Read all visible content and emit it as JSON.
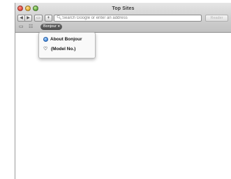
{
  "window": {
    "title": "Top Sites"
  },
  "toolbar": {
    "back_icon": "back-icon",
    "forward_icon": "forward-icon",
    "share_icon": "share-icon",
    "add_tab_label": "+",
    "address_placeholder": "Search Google or enter an address",
    "reader_label": "Reader"
  },
  "bookmarks_bar": {
    "folder_label": "Bonjour",
    "folder_chevron": "▾"
  },
  "dropdown": {
    "items": [
      {
        "label": "About Bonjour",
        "icon": "bonjour-globe-icon"
      },
      {
        "label": "(Model No.)",
        "icon": "device-icon"
      }
    ]
  },
  "colors": {
    "traffic_red": "#e0443a",
    "traffic_yellow": "#e0a82a",
    "traffic_green": "#5aa33a",
    "folder_pill": "#555555"
  }
}
